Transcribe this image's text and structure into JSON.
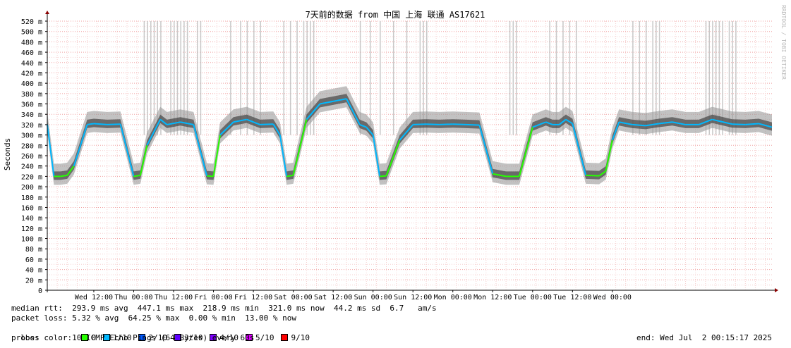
{
  "chart_data": {
    "type": "line",
    "title": "7天前的数据 from 中国 上海 联通 AS17621",
    "ylabel": "Seconds",
    "watermark": "RRDTOOL / TOBI OETIKER",
    "ylim": [
      0,
      520
    ],
    "y_ticks": [
      "0",
      "20 m",
      "40 m",
      "60 m",
      "80 m",
      "100 m",
      "120 m",
      "140 m",
      "160 m",
      "180 m",
      "200 m",
      "220 m",
      "240 m",
      "260 m",
      "280 m",
      "300 m",
      "320 m",
      "340 m",
      "360 m",
      "380 m",
      "400 m",
      "420 m",
      "440 m",
      "460 m",
      "480 m",
      "500 m",
      "520 m"
    ],
    "x_ticks": [
      "Wed 12:00",
      "Thu 00:00",
      "Thu 12:00",
      "Fri 00:00",
      "Fri 12:00",
      "Sat 00:00",
      "Sat 12:00",
      "Sun 00:00",
      "Sun 12:00",
      "Mon 00:00",
      "Mon 12:00",
      "Tue 00:00",
      "Tue 12:00",
      "Wed 00:00"
    ],
    "grid": true,
    "series": [
      {
        "name": "median rtt",
        "x_hours": [
          0,
          2,
          4,
          6,
          8,
          12,
          14,
          18,
          22,
          26,
          28,
          30,
          34,
          36,
          40,
          44,
          48,
          50,
          52,
          56,
          60,
          64,
          68,
          70,
          72,
          74,
          78,
          82,
          86,
          90,
          94,
          96,
          98,
          100,
          102,
          106,
          110,
          114,
          118,
          122,
          126,
          130,
          134,
          138,
          142,
          146,
          150,
          152,
          154,
          156,
          158,
          162,
          166,
          168,
          170,
          172,
          176,
          180,
          184,
          188,
          192,
          196,
          200,
          206,
          210,
          214,
          218
        ],
        "y_ms": [
          320,
          220,
          220,
          222,
          240,
          320,
          322,
          320,
          321,
          220,
          222,
          280,
          330,
          320,
          325,
          320,
          221,
          220,
          300,
          325,
          330,
          320,
          321,
          300,
          220,
          222,
          330,
          360,
          365,
          370,
          320,
          315,
          300,
          220,
          221,
          290,
          320,
          321,
          320,
          321,
          320,
          319,
          225,
          220,
          220,
          315,
          325,
          320,
          320,
          330,
          322,
          222,
          221,
          230,
          290,
          325,
          320,
          318,
          322,
          325,
          320,
          320,
          330,
          321,
          320,
          322,
          315
        ]
      }
    ],
    "loss_overlay": "grey vertical bars indicate packet-loss spikes"
  },
  "stats": {
    "median_rtt": "median rtt:  293.9 ms avg  447.1 ms max  218.9 ms min  321.0 ms now  44.2 ms sd  6.7   am/s",
    "packet_loss": "packet loss: 5.32 % avg  64.25 % max  0.00 % min  13.00 % now",
    "loss_color_label": "loss color:",
    "loss_colors": [
      {
        "label": "0",
        "color": "#26ff00"
      },
      {
        "label": "1/10",
        "color": "#00b8ff"
      },
      {
        "label": "2/10",
        "color": "#0059ff"
      },
      {
        "label": "3/10",
        "color": "#5e00ff"
      },
      {
        "label": "4/10",
        "color": "#7e00ff"
      },
      {
        "label": "5/10",
        "color": "#dd00ff"
      },
      {
        "label": "9/10",
        "color": "#ff0000"
      }
    ],
    "probe": "probe:       10 ICMP Echo Pings (64 Bytes) every 60s",
    "end": "end: Wed Jul  2 00:15:17 2025"
  }
}
